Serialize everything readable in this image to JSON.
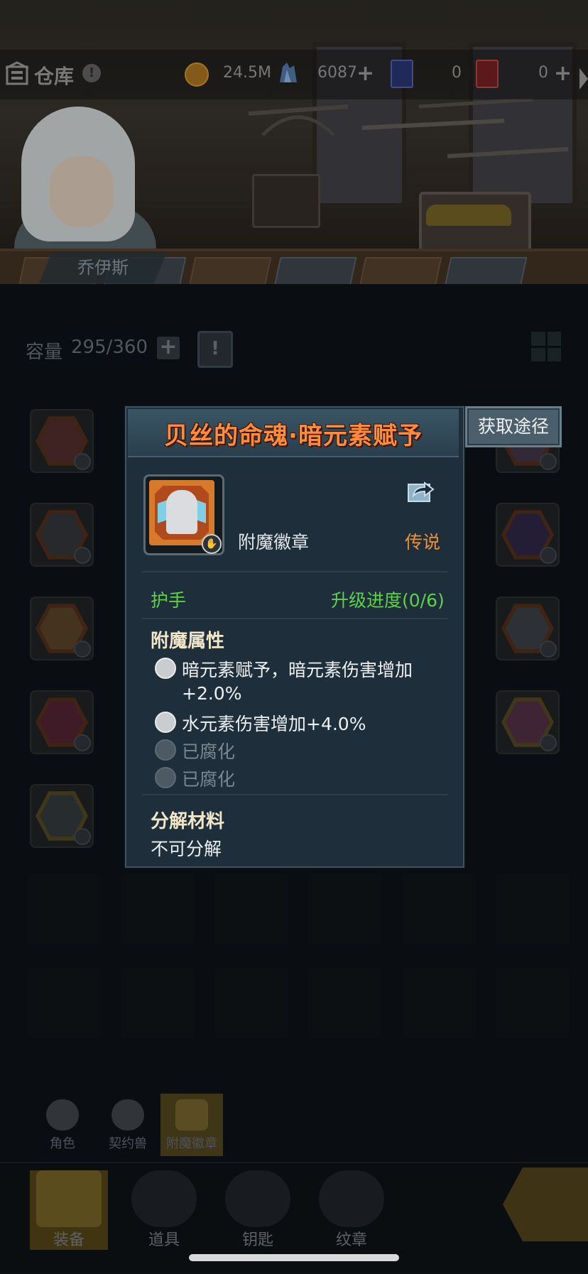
{
  "topbar": {
    "title": "仓库",
    "info_icon": "!",
    "gold": "24.5M",
    "crystal": "6087",
    "blue_cards": "0",
    "red_cards": "0",
    "plus": "+"
  },
  "hero": {
    "name": "乔伊斯"
  },
  "inventory": {
    "capacity_label": "容量",
    "capacity_value": "295/360",
    "plus": "+",
    "bag_icon_text": "!"
  },
  "popup": {
    "title": "贝丝的命魂·暗元素赋予",
    "source_button": "获取途径",
    "item_type": "附魔徽章",
    "rarity": "传说",
    "slot": "护手",
    "upgrade_progress": "升级进度(0/6)",
    "enchant_title": "附魔属性",
    "attributes": [
      {
        "line1": "暗元素赋予，暗元素伤害增加",
        "line2": "+2.0%"
      },
      {
        "line1": "水元素伤害增加+4.0%"
      },
      {
        "line1": "已腐化"
      },
      {
        "line1": "已腐化"
      }
    ],
    "decompose_title": "分解材料",
    "decompose_value": "不可分解",
    "colors": {
      "title": "#ff8c3a",
      "rarity": "#f0913a",
      "green": "#5fd14a"
    }
  },
  "categories": [
    {
      "label": "角色",
      "icon": "character-icon"
    },
    {
      "label": "契约兽",
      "icon": "paw-icon"
    },
    {
      "label": "附魔徽章",
      "icon": "emblem-icon",
      "active": true
    }
  ],
  "nav": [
    {
      "label": "装备",
      "icon": "equipment-icon",
      "active": true
    },
    {
      "label": "道具",
      "icon": "chest-icon"
    },
    {
      "label": "钥匙",
      "icon": "key-icon"
    },
    {
      "label": "纹章",
      "icon": "crest-icon"
    }
  ]
}
